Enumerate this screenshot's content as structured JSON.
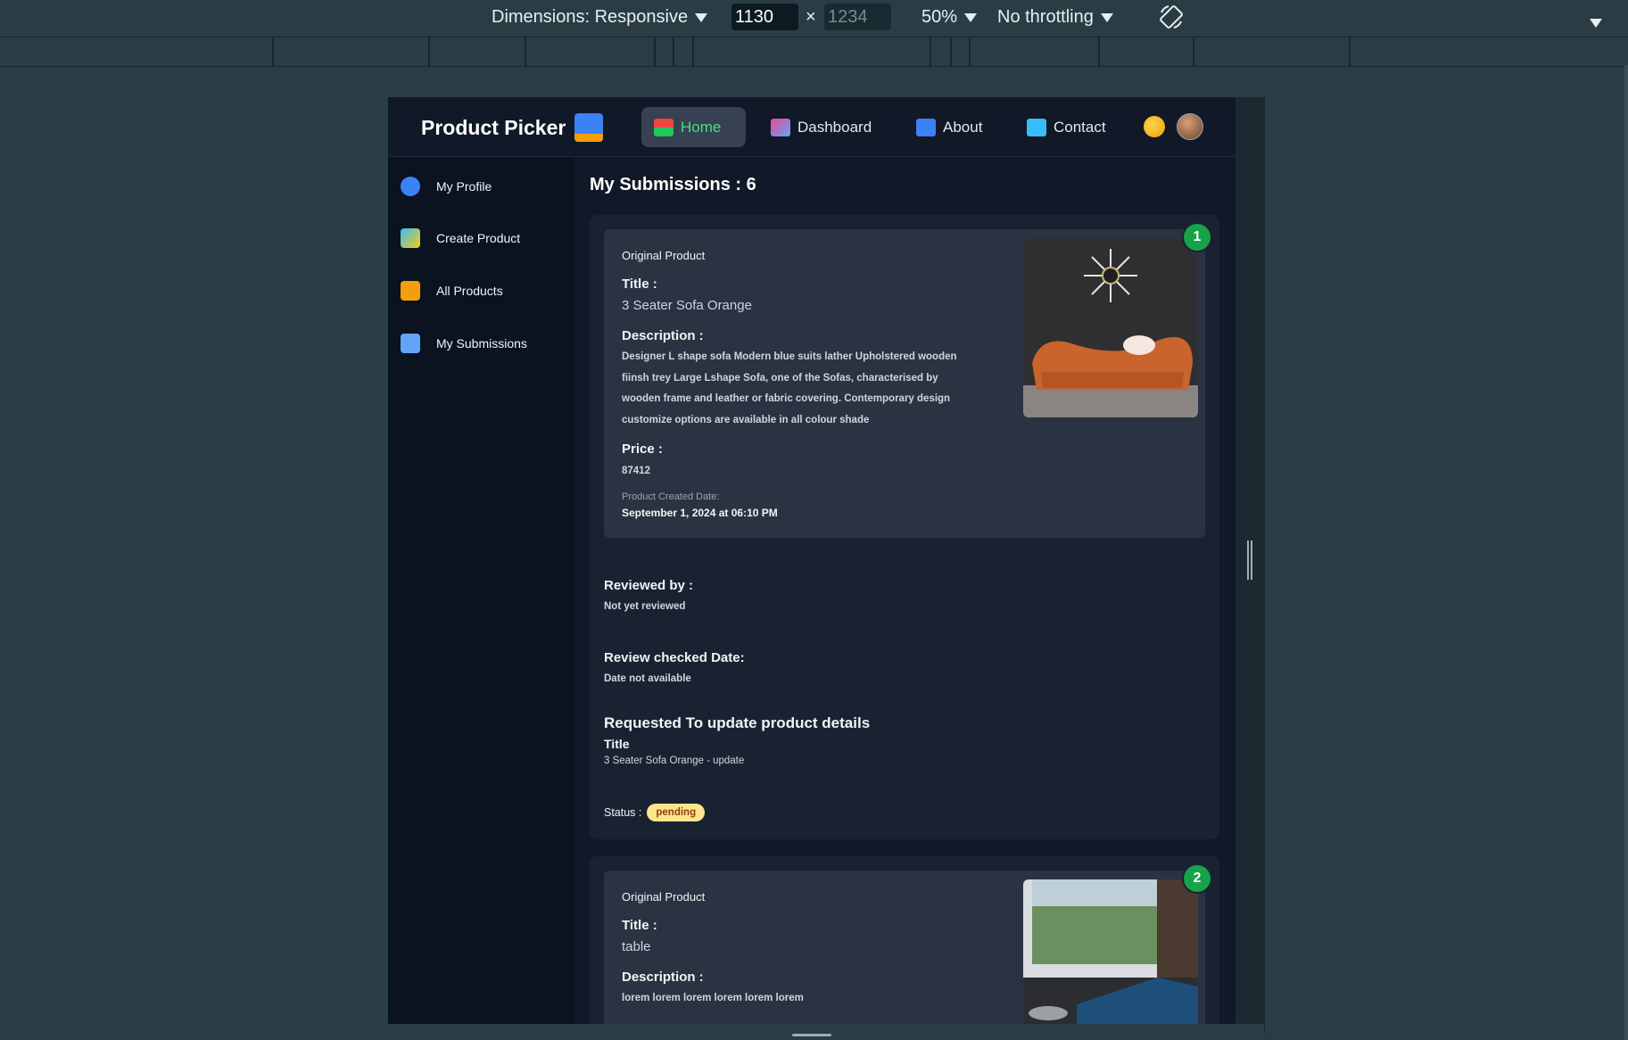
{
  "devtools": {
    "dimensions_label": "Dimensions: Responsive",
    "width": "1130",
    "height_placeholder": "1234",
    "times": "×",
    "zoom": "50%",
    "throttling": "No throttling"
  },
  "nav": {
    "brand": "Product Picker",
    "links": [
      "Home",
      "Dashboard",
      "About",
      "Contact"
    ]
  },
  "sidebar": {
    "items": [
      "My Profile",
      "Create Product",
      "All Products",
      "My Submissions"
    ]
  },
  "main": {
    "title": "My Submissions : 6",
    "submissions": [
      {
        "index": "1",
        "original_label": "Original Product",
        "title_label": "Title :",
        "title": "3 Seater Sofa Orange",
        "description_label": "Description :",
        "description": "Designer L shape sofa Modern blue suits lather Upholstered wooden fiinsh trey Large Lshape Sofa, one of the Sofas, characterised by wooden frame and leather or fabric covering. Contemporary design customize options are available in all colour shade",
        "price_label": "Price :",
        "price": "87412",
        "created_label": "Product Created Date:",
        "created": "September 1, 2024 at 06:10 PM",
        "reviewed_by_label": "Reviewed by :",
        "reviewed_by": "Not yet reviewed",
        "review_date_label": "Review checked Date:",
        "review_date": "Date not available",
        "requested_label": "Requested To update product details",
        "req_field_label": "Title",
        "req_field_value": "3 Seater Sofa Orange - update",
        "status_label": "Status :",
        "status": "pending"
      },
      {
        "index": "2",
        "original_label": "Original Product",
        "title_label": "Title :",
        "title": "table",
        "description_label": "Description :",
        "description": "lorem lorem lorem lorem lorem lorem"
      }
    ]
  },
  "colors": {
    "accent_green": "#4ade80",
    "badge_green": "#16a34a",
    "pending_bg": "#fde68a"
  },
  "icons": [
    "home-icon",
    "dashboard-icon",
    "about-icon",
    "contact-icon",
    "theme-sun-icon",
    "user-avatar",
    "profile-icon",
    "create-icon",
    "products-icon",
    "submissions-icon"
  ]
}
